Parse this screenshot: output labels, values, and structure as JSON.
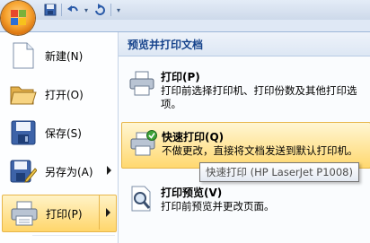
{
  "quick_access": {
    "icons": [
      "save-icon",
      "undo-icon",
      "redo-icon",
      "customize-dropdown-icon"
    ]
  },
  "menu": {
    "items": [
      {
        "label": "新建(N)",
        "icon": "new-document-icon"
      },
      {
        "label": "打开(O)",
        "icon": "open-folder-icon"
      },
      {
        "label": "保存(S)",
        "icon": "save-icon"
      },
      {
        "label": "另存为(A)",
        "icon": "save-as-icon"
      },
      {
        "label": "打印(P)",
        "icon": "printer-icon"
      }
    ]
  },
  "submenu": {
    "header": "预览并打印文档",
    "items": [
      {
        "title": "打印(P)",
        "description_line1": "打印前选择打印机、打印份数及其他打印选",
        "description_line2": "项。"
      },
      {
        "title": "快速打印(Q)",
        "description_line1": "不做更改，直接将文档发送到默认打印机。"
      },
      {
        "title": "打印预览(V)",
        "description_line1": "打印前预览并更改页面。"
      }
    ]
  },
  "tooltip": {
    "text": "快速打印 (HP LaserJet P1008)"
  },
  "colors": {
    "accent": "#15428b",
    "highlight": "#ffd66b",
    "highlight_border": "#e7b64a"
  }
}
